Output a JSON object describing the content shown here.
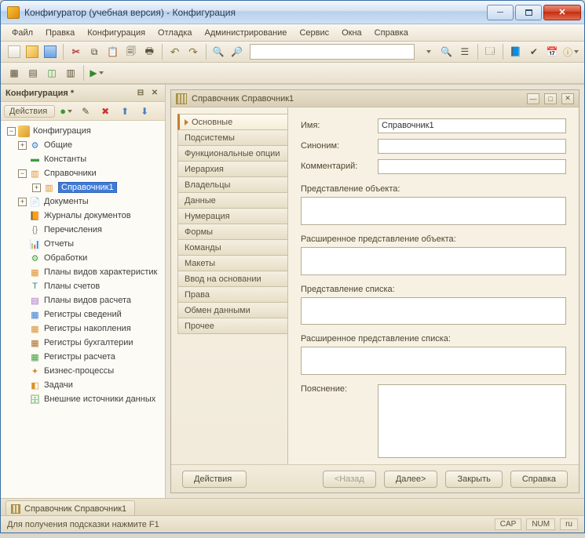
{
  "window": {
    "title": "Конфигуратор (учебная версия) - Конфигурация"
  },
  "menu": {
    "file": "Файл",
    "edit": "Правка",
    "config": "Конфигурация",
    "debug": "Отладка",
    "admin": "Администрирование",
    "service": "Сервис",
    "windows": "Окна",
    "help": "Справка"
  },
  "left_pane": {
    "title": "Конфигурация *",
    "actions_label": "Действия"
  },
  "tree": {
    "root": "Конфигурация",
    "common": "Общие",
    "constants": "Константы",
    "catalogs": "Справочники",
    "catalog1": "Справочник1",
    "documents": "Документы",
    "doc_journals": "Журналы документов",
    "enums": "Перечисления",
    "reports": "Отчеты",
    "processings": "Обработки",
    "char_plans": "Планы видов характеристик",
    "acc_plans": "Планы счетов",
    "calc_plans": "Планы видов расчета",
    "info_regs": "Регистры сведений",
    "accum_regs": "Регистры накопления",
    "acct_regs": "Регистры бухгалтерии",
    "calc_regs": "Регистры расчета",
    "bproc": "Бизнес-процессы",
    "tasks": "Задачи",
    "ext_ds": "Внешние источники данных"
  },
  "editor": {
    "title": "Справочник Справочник1",
    "tabs": {
      "main": "Основные",
      "subsystems": "Подсистемы",
      "func_options": "Функциональные опции",
      "hierarchy": "Иерархия",
      "owners": "Владельцы",
      "data": "Данные",
      "numbering": "Нумерация",
      "forms": "Формы",
      "commands": "Команды",
      "templates": "Макеты",
      "input_basis": "Ввод на основании",
      "rights": "Права",
      "data_exchange": "Обмен данными",
      "other": "Прочее"
    },
    "form": {
      "name_label": "Имя:",
      "name_value": "Справочник1",
      "synonym_label": "Синоним:",
      "synonym_value": "",
      "comment_label": "Комментарий:",
      "comment_value": "",
      "obj_presentation_label": "Представление объекта:",
      "obj_presentation_value": "",
      "ext_obj_presentation_label": "Расширенное представление объекта:",
      "ext_obj_presentation_value": "",
      "list_presentation_label": "Представление списка:",
      "list_presentation_value": "",
      "ext_list_presentation_label": "Расширенное представление списка:",
      "ext_list_presentation_value": "",
      "explanation_label": "Пояснение:",
      "explanation_value": ""
    },
    "buttons": {
      "actions": "Действия",
      "back": "<Назад",
      "next": "Далее>",
      "close": "Закрыть",
      "help": "Справка"
    }
  },
  "doc_tab": {
    "label": "Справочник Справочник1"
  },
  "status": {
    "hint": "Для получения подсказки нажмите F1",
    "cap": "CAP",
    "num": "NUM",
    "lang": "ru"
  }
}
